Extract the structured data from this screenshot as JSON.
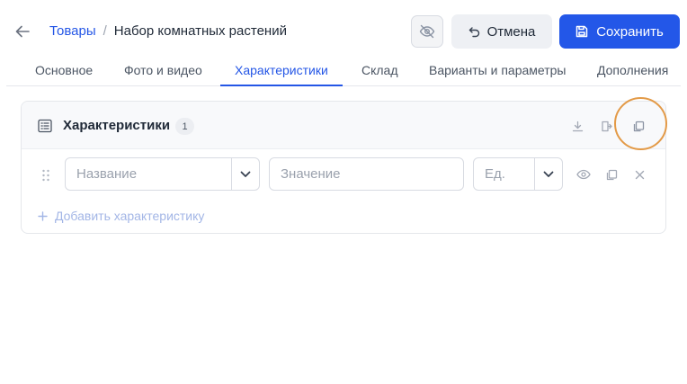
{
  "breadcrumb": {
    "parent": "Товары",
    "separator": "/",
    "current": "Набор комнатных растений"
  },
  "toolbar": {
    "visibility_icon": "eye-off-icon",
    "cancel_label": "Отмена",
    "save_label": "Сохранить"
  },
  "tabs": [
    {
      "label": "Основное"
    },
    {
      "label": "Фото и видео"
    },
    {
      "label": "Характеристики",
      "active": true
    },
    {
      "label": "Склад"
    },
    {
      "label": "Варианты и параметры"
    },
    {
      "label": "Дополнения"
    }
  ],
  "characteristics": {
    "title": "Характеристики",
    "count": "1",
    "header_icons": [
      "download-icon",
      "import-icon",
      "copy-icon"
    ],
    "row": {
      "name_placeholder": "Название",
      "value_placeholder": "Значение",
      "unit_placeholder": "Ед.",
      "row_icons": [
        "eye-icon",
        "copy-icon",
        "close-icon"
      ]
    },
    "add_label": "Добавить характеристику"
  },
  "colors": {
    "accent": "#2357e8",
    "link": "#2456e6",
    "highlight": "#e39a47"
  }
}
